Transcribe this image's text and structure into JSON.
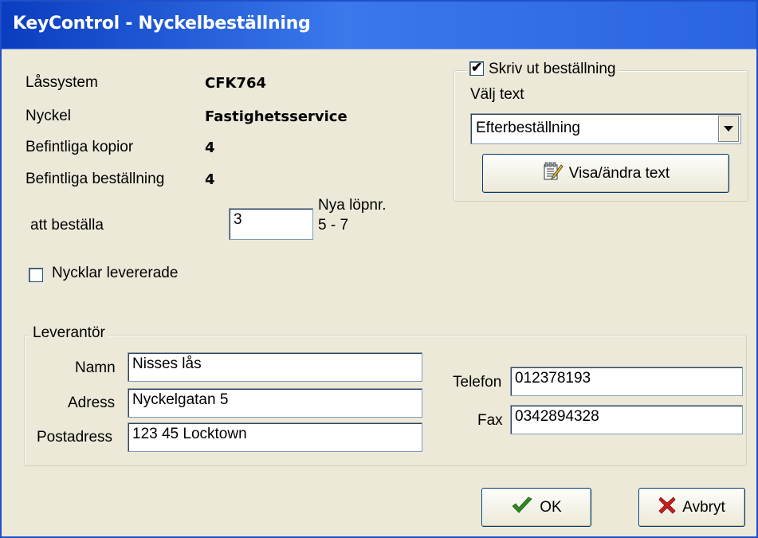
{
  "window": {
    "title": "KeyControl - Nyckelbeställning"
  },
  "info": {
    "lassystem_label": "Låssystem",
    "lassystem_value": "CFK764",
    "nyckel_label": "Nyckel",
    "nyckel_value": "Fastighetsservice",
    "kopior_label": "Befintliga kopior",
    "kopior_value": "4",
    "bestallning_label": "Befintliga beställning",
    "bestallning_value": "4",
    "att_bestalla_label": "att beställa",
    "att_bestalla_value": "3",
    "nya_lopnr_label": "Nya löpnr.",
    "nya_lopnr_value": "5 - 7",
    "delivered_label": "Nycklar levererade",
    "delivered_checked": false
  },
  "print_group": {
    "checkbox_label": "Skriv ut beställning",
    "checkbox_checked": true,
    "valj_text_label": "Välj text",
    "selected_text": "Efterbeställning",
    "edit_button_label": "Visa/ändra text",
    "edit_icon": "notepad-edit-icon"
  },
  "supplier": {
    "legend": "Leverantör",
    "namn_label": "Namn",
    "namn_value": "Nisses lås",
    "adress_label": "Adress",
    "adress_value": "Nyckelgatan 5",
    "postadress_label": "Postadress",
    "postadress_value": "123 45 Locktown",
    "telefon_label": "Telefon",
    "telefon_value": "012378193",
    "fax_label": "Fax",
    "fax_value": "0342894328"
  },
  "buttons": {
    "ok_label": "OK",
    "ok_icon": "checkmark-icon",
    "ok_color": "#2e8b1e",
    "cancel_label": "Avbryt",
    "cancel_icon": "x-icon",
    "cancel_color": "#c81e1e"
  }
}
